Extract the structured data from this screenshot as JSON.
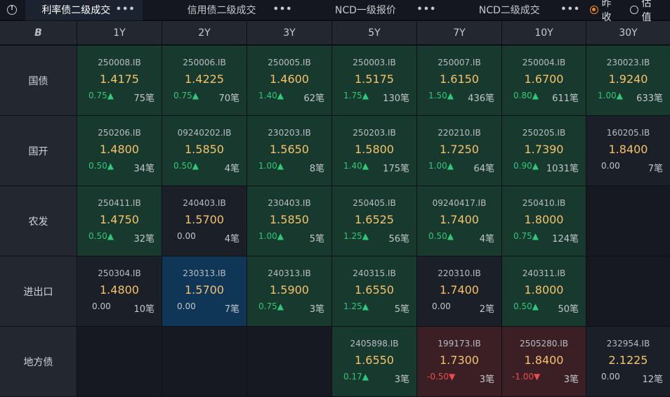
{
  "tabs": [
    {
      "label": "利率债二级成交",
      "more": "•••",
      "active": true
    },
    {
      "label": "信用债二级成交",
      "more": "•••",
      "active": false
    },
    {
      "label": "NCD一级报价",
      "more": "•••",
      "active": false
    },
    {
      "label": "NCD二级成交",
      "more": "•••",
      "active": false
    }
  ],
  "radios": [
    {
      "label": "昨收",
      "selected": true
    },
    {
      "label": "估值",
      "selected": false
    }
  ],
  "corner_logo": "B",
  "terms": [
    "1Y",
    "2Y",
    "3Y",
    "5Y",
    "7Y",
    "10Y",
    "30Y"
  ],
  "rows": [
    {
      "label": "国债",
      "cells": [
        {
          "code": "250008.IB",
          "rate": "1.4175",
          "chg": "0.75▲",
          "dir": "up",
          "count": "75笔",
          "bg": "green"
        },
        {
          "code": "250006.IB",
          "rate": "1.4225",
          "chg": "0.75▲",
          "dir": "up",
          "count": "70笔",
          "bg": "green"
        },
        {
          "code": "250005.IB",
          "rate": "1.4600",
          "chg": "1.40▲",
          "dir": "up",
          "count": "62笔",
          "bg": "green"
        },
        {
          "code": "250003.IB",
          "rate": "1.5175",
          "chg": "1.75▲",
          "dir": "up",
          "count": "130笔",
          "bg": "green"
        },
        {
          "code": "250007.IB",
          "rate": "1.6150",
          "chg": "1.50▲",
          "dir": "up",
          "count": "436笔",
          "bg": "green"
        },
        {
          "code": "250004.IB",
          "rate": "1.6700",
          "chg": "0.80▲",
          "dir": "up",
          "count": "611笔",
          "bg": "green"
        },
        {
          "code": "230023.IB",
          "rate": "1.9240",
          "chg": "1.00▲",
          "dir": "up",
          "count": "633笔",
          "bg": "green"
        }
      ]
    },
    {
      "label": "国开",
      "cells": [
        {
          "code": "250206.IB",
          "rate": "1.4800",
          "chg": "0.50▲",
          "dir": "up",
          "count": "34笔",
          "bg": "green"
        },
        {
          "code": "09240202.IB",
          "rate": "1.5850",
          "chg": "0.50▲",
          "dir": "up",
          "count": "4笔",
          "bg": "green"
        },
        {
          "code": "230203.IB",
          "rate": "1.5650",
          "chg": "1.00▲",
          "dir": "up",
          "count": "8笔",
          "bg": "green"
        },
        {
          "code": "250203.IB",
          "rate": "1.5800",
          "chg": "1.40▲",
          "dir": "up",
          "count": "175笔",
          "bg": "green"
        },
        {
          "code": "220210.IB",
          "rate": "1.7250",
          "chg": "1.00▲",
          "dir": "up",
          "count": "64笔",
          "bg": "green"
        },
        {
          "code": "250205.IB",
          "rate": "1.7390",
          "chg": "0.90▲",
          "dir": "up",
          "count": "1031笔",
          "bg": "green"
        },
        {
          "code": "160205.IB",
          "rate": "1.8400",
          "chg": "0.00",
          "dir": "flat",
          "count": "7笔",
          "bg": "dark"
        }
      ]
    },
    {
      "label": "农发",
      "cells": [
        {
          "code": "250411.IB",
          "rate": "1.4750",
          "chg": "0.50▲",
          "dir": "up",
          "count": "32笔",
          "bg": "green"
        },
        {
          "code": "240403.IB",
          "rate": "1.5700",
          "chg": "0.00",
          "dir": "flat",
          "count": "4笔",
          "bg": "dark"
        },
        {
          "code": "230403.IB",
          "rate": "1.5850",
          "chg": "1.00▲",
          "dir": "up",
          "count": "5笔",
          "bg": "green"
        },
        {
          "code": "250405.IB",
          "rate": "1.6525",
          "chg": "1.25▲",
          "dir": "up",
          "count": "56笔",
          "bg": "green"
        },
        {
          "code": "09240417.IB",
          "rate": "1.7400",
          "chg": "0.50▲",
          "dir": "up",
          "count": "4笔",
          "bg": "green"
        },
        {
          "code": "250410.IB",
          "rate": "1.8000",
          "chg": "0.75▲",
          "dir": "up",
          "count": "124笔",
          "bg": "green"
        },
        null
      ]
    },
    {
      "label": "进出口",
      "cells": [
        {
          "code": "250304.IB",
          "rate": "1.4800",
          "chg": "0.00",
          "dir": "flat",
          "count": "10笔",
          "bg": "dark"
        },
        {
          "code": "230313.IB",
          "rate": "1.5700",
          "chg": "0.00",
          "dir": "flat",
          "count": "7笔",
          "bg": "blue"
        },
        {
          "code": "240313.IB",
          "rate": "1.5900",
          "chg": "0.75▲",
          "dir": "up",
          "count": "3笔",
          "bg": "green"
        },
        {
          "code": "240315.IB",
          "rate": "1.6550",
          "chg": "1.25▲",
          "dir": "up",
          "count": "5笔",
          "bg": "green"
        },
        {
          "code": "220310.IB",
          "rate": "1.7400",
          "chg": "0.00",
          "dir": "flat",
          "count": "2笔",
          "bg": "dark"
        },
        {
          "code": "240311.IB",
          "rate": "1.8000",
          "chg": "0.50▲",
          "dir": "up",
          "count": "50笔",
          "bg": "green"
        },
        null
      ]
    },
    {
      "label": "地方债",
      "cells": [
        null,
        null,
        null,
        {
          "code": "2405898.IB",
          "rate": "1.6550",
          "chg": "0.17▲",
          "dir": "up",
          "count": "3笔",
          "bg": "green"
        },
        {
          "code": "199173.IB",
          "rate": "1.7300",
          "chg": "-0.50▼",
          "dir": "down",
          "count": "3笔",
          "bg": "red"
        },
        {
          "code": "2505280.IB",
          "rate": "1.8400",
          "chg": "-1.00▼",
          "dir": "down",
          "count": "3笔",
          "bg": "red"
        },
        {
          "code": "232954.IB",
          "rate": "2.1225",
          "chg": "0.00",
          "dir": "flat",
          "count": "12笔",
          "bg": "dark"
        }
      ]
    }
  ]
}
